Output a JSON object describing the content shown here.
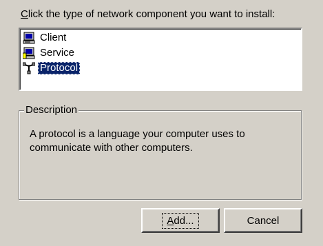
{
  "dialog": {
    "instruction_accel": "C",
    "instruction_rest": "lick the type of network component you want to install:"
  },
  "components": [
    {
      "label": "Client",
      "icon": "computer-icon",
      "selected": false
    },
    {
      "label": "Service",
      "icon": "computer-service-icon",
      "selected": false
    },
    {
      "label": "Protocol",
      "icon": "network-cable-icon",
      "selected": true
    }
  ],
  "description": {
    "legend": "Description",
    "text": "A protocol is a language your computer uses to communicate with other computers."
  },
  "buttons": {
    "add_accel": "A",
    "add_rest": "dd...",
    "cancel": "Cancel"
  },
  "colors": {
    "face": "#d4d0c8",
    "selection": "#0a246a"
  }
}
